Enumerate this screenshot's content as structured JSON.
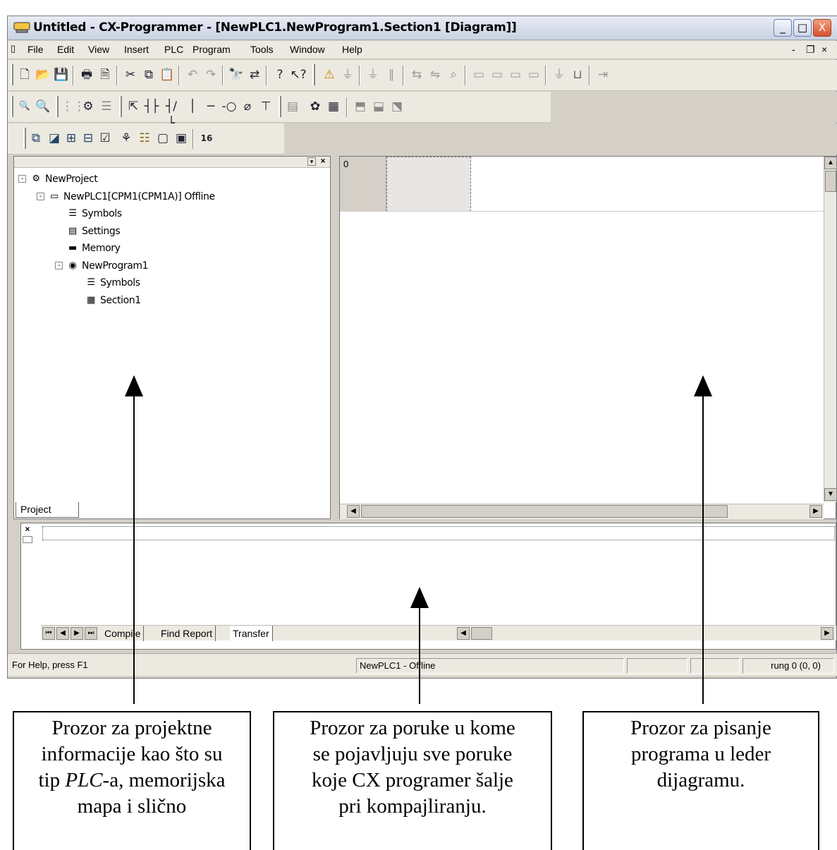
{
  "window": {
    "title": "Untitled - CX-Programmer - [NewPLC1.NewProgram1.Section1 [Diagram]]",
    "controls": {
      "minimize": "_",
      "maximize": "□",
      "close": "X"
    }
  },
  "menubar": {
    "items": [
      "File",
      "Edit",
      "View",
      "Insert",
      "PLC",
      "Program",
      "Tools",
      "Window",
      "Help"
    ],
    "mdi_controls": [
      "-",
      "❐",
      "×"
    ]
  },
  "toolbar_main": {
    "icons": [
      "new-icon",
      "open-icon",
      "save-icon",
      "print-icon",
      "print-preview-icon",
      "cut-icon",
      "copy-icon",
      "paste-icon",
      "undo-icon",
      "redo-icon",
      "find-icon",
      "replace-icon",
      "help-icon",
      "context-help-icon",
      "warning-icon",
      "online-icon",
      "monitor-icon",
      "pause-icon",
      "transfer-icon",
      "compare-icon",
      "verify-icon",
      "plc-icon-1",
      "plc-icon-2",
      "plc-icon-3",
      "plc-icon-4",
      "step-icon",
      "io-icon",
      "connect-icon"
    ]
  },
  "toolbar_ladder": {
    "icons": [
      "zoom-out-icon",
      "zoom-in-icon",
      "grid-icon",
      "symbol-icon",
      "table-icon",
      "select-icon",
      "contact-no-icon",
      "contact-nc-icon",
      "vertical-line-icon",
      "horizontal-line-icon",
      "coil-icon",
      "coil-nc-icon",
      "instruction-icon",
      "compile-icon",
      "settings-icon",
      "memory-icon",
      "rung-icon-1",
      "rung-icon-2",
      "rung-icon-3"
    ]
  },
  "toolbar_view": {
    "icons": [
      "project-window-icon",
      "output-window-icon",
      "watch-window-icon",
      "address-ref-icon",
      "properties-icon",
      "cross-ref-icon",
      "io-table-icon",
      "symbol-table-icon",
      "memory-view-icon",
      "hex-icon"
    ],
    "hex_label": "16"
  },
  "project_tree": {
    "nodes": [
      {
        "label": "NewProject",
        "icon": "project-icon",
        "depth": 0,
        "expander": "-"
      },
      {
        "label": "NewPLC1[CPM1(CPM1A)] Offline",
        "icon": "plc-icon",
        "depth": 1,
        "expander": "-"
      },
      {
        "label": "Symbols",
        "icon": "symbols-icon",
        "depth": 2,
        "expander": ""
      },
      {
        "label": "Settings",
        "icon": "settings-icon",
        "depth": 2,
        "expander": ""
      },
      {
        "label": "Memory",
        "icon": "memory-icon",
        "depth": 2,
        "expander": ""
      },
      {
        "label": "NewProgram1",
        "icon": "program-icon",
        "depth": 2,
        "expander": "-"
      },
      {
        "label": "Symbols",
        "icon": "symbols-icon",
        "depth": 3,
        "expander": ""
      },
      {
        "label": "Section1",
        "icon": "section-icon",
        "depth": 3,
        "expander": ""
      }
    ],
    "tab_label": "Project"
  },
  "diagram": {
    "rung_number": "0"
  },
  "output": {
    "tabs": [
      "Compile",
      "Find Report",
      "Transfer"
    ]
  },
  "statusbar": {
    "help": "For Help, press F1",
    "plc_status": "NewPLC1 - Offline",
    "position": "rung 0 (0, 0)"
  },
  "annotations": [
    {
      "text": "Prozor za projektne informacije kao što su tip PLC-a, memorijska mapa i slično",
      "lines": [
        "Prozor za projektne",
        "informacije kao što su",
        "tip PLC-a, memorijska",
        "mapa i slično"
      ]
    },
    {
      "text": "Prozor za poruke u kome se pojavljuju sve poruke koje CX programer šalje pri kompajliranju.",
      "lines": [
        "Prozor za poruke u kome",
        "se pojavljuju sve poruke",
        "koje CX programer šalje",
        "pri kompajliranju."
      ]
    },
    {
      "text": "Prozor za pisanje programa u leder dijagramu.",
      "lines": [
        "Prozor za pisanje",
        "programa u leder",
        "dijagramu."
      ]
    }
  ]
}
